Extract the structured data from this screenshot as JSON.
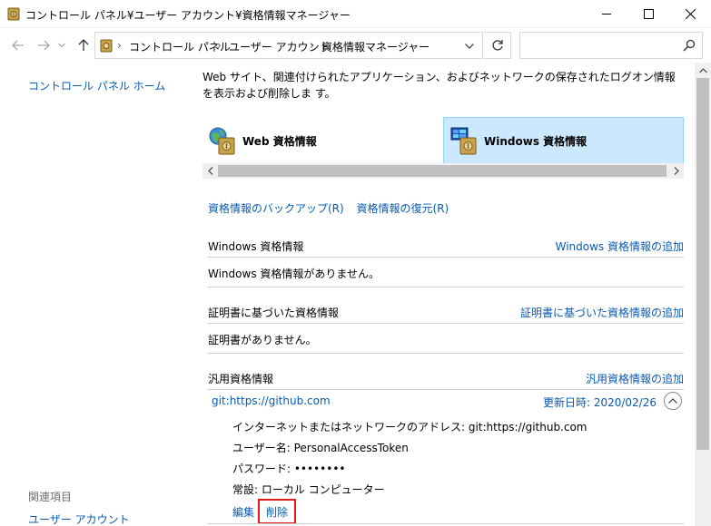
{
  "window": {
    "title": "コントロール パネル¥ユーザー アカウント¥資格情報マネージャー",
    "icon": "credential-vault-icon"
  },
  "address": {
    "crumbs": [
      "コントロール パネル",
      "ユーザー アカウント",
      "資格情報マネージャー"
    ],
    "search_placeholder": ""
  },
  "sidebar": {
    "home": "コントロール パネル ホーム",
    "related_heading": "関連項目",
    "related_items": [
      "ユーザー アカウント"
    ]
  },
  "main": {
    "description": "Web サイト、関連付けられたアプリケーション、およびネットワークの保存されたログオン情報を表示および削除しま す。",
    "tabs": [
      {
        "label": "Web 資格情報",
        "icon": "web-credential-icon",
        "selected": false
      },
      {
        "label": "Windows 資格情報",
        "icon": "windows-credential-icon",
        "selected": true
      }
    ],
    "backup_link": "資格情報のバックアップ(R)",
    "restore_link": "資格情報の復元(R)",
    "sections": [
      {
        "title": "Windows 資格情報",
        "add": "Windows 資格情報の追加",
        "empty": "Windows 資格情報がありません。"
      },
      {
        "title": "証明書に基づいた資格情報",
        "add": "証明書に基づいた資格情報の追加",
        "empty": "証明書がありません。"
      },
      {
        "title": "汎用資格情報",
        "add": "汎用資格情報の追加"
      }
    ],
    "generic_item": {
      "name": "git:https://github.com",
      "updated": "更新日時:  2020/02/26",
      "details": [
        "インターネットまたはネットワークのアドレス:  git:https://github.com",
        "ユーザー名:  PersonalAccessToken",
        "パスワード:  ••••••••",
        "常設:  ローカル コンピューター"
      ],
      "edit": "編集",
      "delete": "削除"
    }
  },
  "colors": {
    "link": "#0a5bb3",
    "selected_tab": "#cce8ff",
    "highlight_box": "#e01b1b"
  }
}
